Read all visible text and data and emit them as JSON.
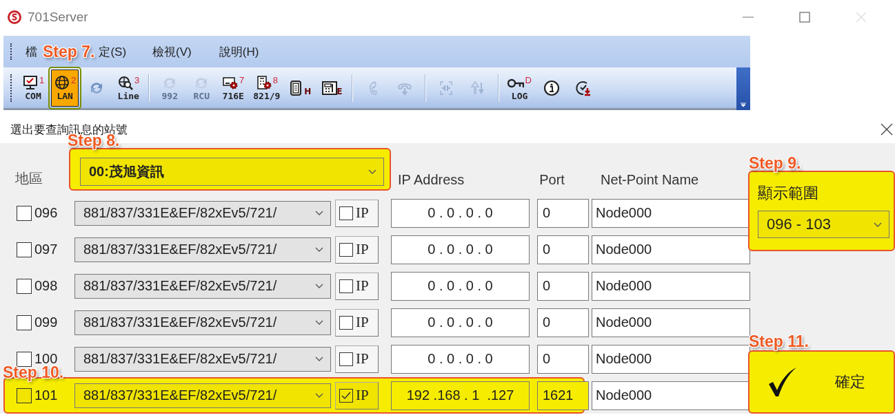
{
  "window": {
    "title": "701Server"
  },
  "menu": [
    {
      "label": "檔"
    },
    {
      "label": "定(S)"
    },
    {
      "label": "檢視(V)"
    },
    {
      "label": "說明(H)"
    }
  ],
  "menu_step": "Step 7.",
  "toolbar": [
    {
      "kind": "button",
      "label": "COM",
      "badge": "1",
      "selected": false,
      "disabled": false
    },
    {
      "kind": "button",
      "label": "LAN",
      "badge": "2",
      "selected": true,
      "disabled": false
    },
    {
      "kind": "button",
      "selected": false,
      "disabled": false
    },
    {
      "kind": "button",
      "label": "Line",
      "badge": "3",
      "selected": false,
      "disabled": false
    },
    {
      "kind": "separator"
    },
    {
      "kind": "button",
      "label": "992",
      "selected": false,
      "disabled": true
    },
    {
      "kind": "button",
      "label": "RCU",
      "selected": false,
      "disabled": true
    },
    {
      "kind": "button",
      "label": "716E",
      "badge": "7",
      "selected": false,
      "disabled": false
    },
    {
      "kind": "button",
      "label": "821/9",
      "badge": "8",
      "selected": false,
      "disabled": false
    },
    {
      "kind": "button",
      "letter": "H",
      "selected": false,
      "disabled": false
    },
    {
      "kind": "button",
      "letter": "E",
      "selected": false,
      "disabled": false
    },
    {
      "kind": "separator"
    },
    {
      "kind": "button",
      "selected": false,
      "disabled": true
    },
    {
      "kind": "button",
      "selected": false,
      "disabled": true
    },
    {
      "kind": "separator"
    },
    {
      "kind": "button",
      "selected": false,
      "disabled": true
    },
    {
      "kind": "button",
      "selected": false,
      "disabled": true
    },
    {
      "kind": "separator"
    },
    {
      "kind": "button",
      "label": "LOG",
      "badge": "D",
      "selected": false,
      "disabled": false
    },
    {
      "kind": "button",
      "selected": false,
      "disabled": false
    },
    {
      "kind": "button",
      "selected": false,
      "disabled": false
    }
  ],
  "dialog": {
    "title": "選出要查詢訊息的站號",
    "region_label": "地區",
    "region": {
      "value": "00:茂旭資訊",
      "highlighted": true,
      "step": "Step 8."
    },
    "columns": [
      "IP Address",
      "Port",
      "Net-Point Name"
    ],
    "rows": [
      {
        "checked": false,
        "number": "096",
        "device": "881/837/331E&EF/82xEv5/721/",
        "ip_checked": false,
        "ip_label": "IP",
        "ip": "0 . 0 . 0 . 0",
        "port": "0",
        "name": "Node000",
        "highlighted": false
      },
      {
        "checked": false,
        "number": "097",
        "device": "881/837/331E&EF/82xEv5/721/",
        "ip_checked": false,
        "ip_label": "IP",
        "ip": "0 . 0 . 0 . 0",
        "port": "0",
        "name": "Node000",
        "highlighted": false
      },
      {
        "checked": false,
        "number": "098",
        "device": "881/837/331E&EF/82xEv5/721/",
        "ip_checked": false,
        "ip_label": "IP",
        "ip": "0 . 0 . 0 . 0",
        "port": "0",
        "name": "Node000",
        "highlighted": false
      },
      {
        "checked": false,
        "number": "099",
        "device": "881/837/331E&EF/82xEv5/721/",
        "ip_checked": false,
        "ip_label": "IP",
        "ip": "0 . 0 . 0 . 0",
        "port": "0",
        "name": "Node000",
        "highlighted": false
      },
      {
        "checked": false,
        "number": "100",
        "device": "881/837/331E&EF/82xEv5/721/",
        "ip_checked": false,
        "ip_label": "IP",
        "ip": "0 . 0 . 0 . 0",
        "port": "0",
        "name": "Node000",
        "highlighted": false
      },
      {
        "checked": false,
        "number": "101",
        "device": "881/837/331E&EF/82xEv5/721/",
        "ip_checked": true,
        "ip_label": "IP",
        "ip": "192 .168 . 1  .127",
        "port": "1621",
        "name": "Node000",
        "highlighted": true,
        "step": "Step 10."
      }
    ],
    "range": {
      "label": "顯示範圍",
      "value": "096 - 103",
      "highlighted": true,
      "step": "Step 9."
    },
    "ok": {
      "label": "確定",
      "highlighted": true,
      "step": "Step 11."
    }
  }
}
